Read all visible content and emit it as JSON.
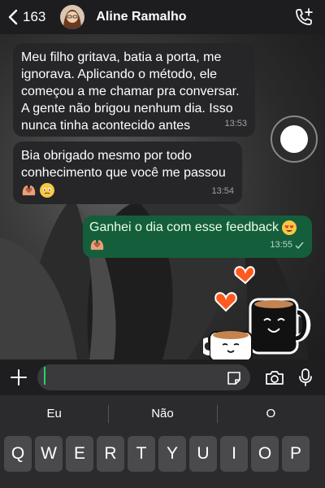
{
  "header": {
    "back_count": "163",
    "contact_name": "Aline Ramalho"
  },
  "messages": [
    {
      "direction": "incoming",
      "text": "Meu filho gritava, batia a porta, me ignorava. Aplicando o método, ele começou a me chamar pra conversar. A gente não brigou nenhum dia. Isso nunca tinha acontecido antes",
      "time": "13:53"
    },
    {
      "direction": "incoming",
      "text": "Bia obrigado mesmo por todo conhecimento que você me passou",
      "emojis": [
        "heart-hands",
        "holding-back-tears"
      ],
      "time": "13:54"
    },
    {
      "direction": "outgoing",
      "text": "Ganhei o dia com esse feedback",
      "emojis": [
        "heart-eyes",
        "heart-hands"
      ],
      "time": "13:55",
      "status": "sent"
    }
  ],
  "input": {
    "value": "",
    "placeholder": ""
  },
  "keyboard": {
    "suggestions": [
      "Eu",
      "Não",
      "O"
    ],
    "row1": [
      "Q",
      "W",
      "E",
      "R",
      "T",
      "Y",
      "U",
      "I",
      "O",
      "P"
    ]
  },
  "icons": {
    "back": "chevron-left-icon",
    "call": "add-call-icon",
    "plus": "plus-icon",
    "sticker": "sticker-icon",
    "camera": "camera-icon",
    "mic": "microphone-icon"
  },
  "colors": {
    "outgoing_bubble": "#155e3b",
    "incoming_bubble": "#262628",
    "accent": "#25d366"
  }
}
